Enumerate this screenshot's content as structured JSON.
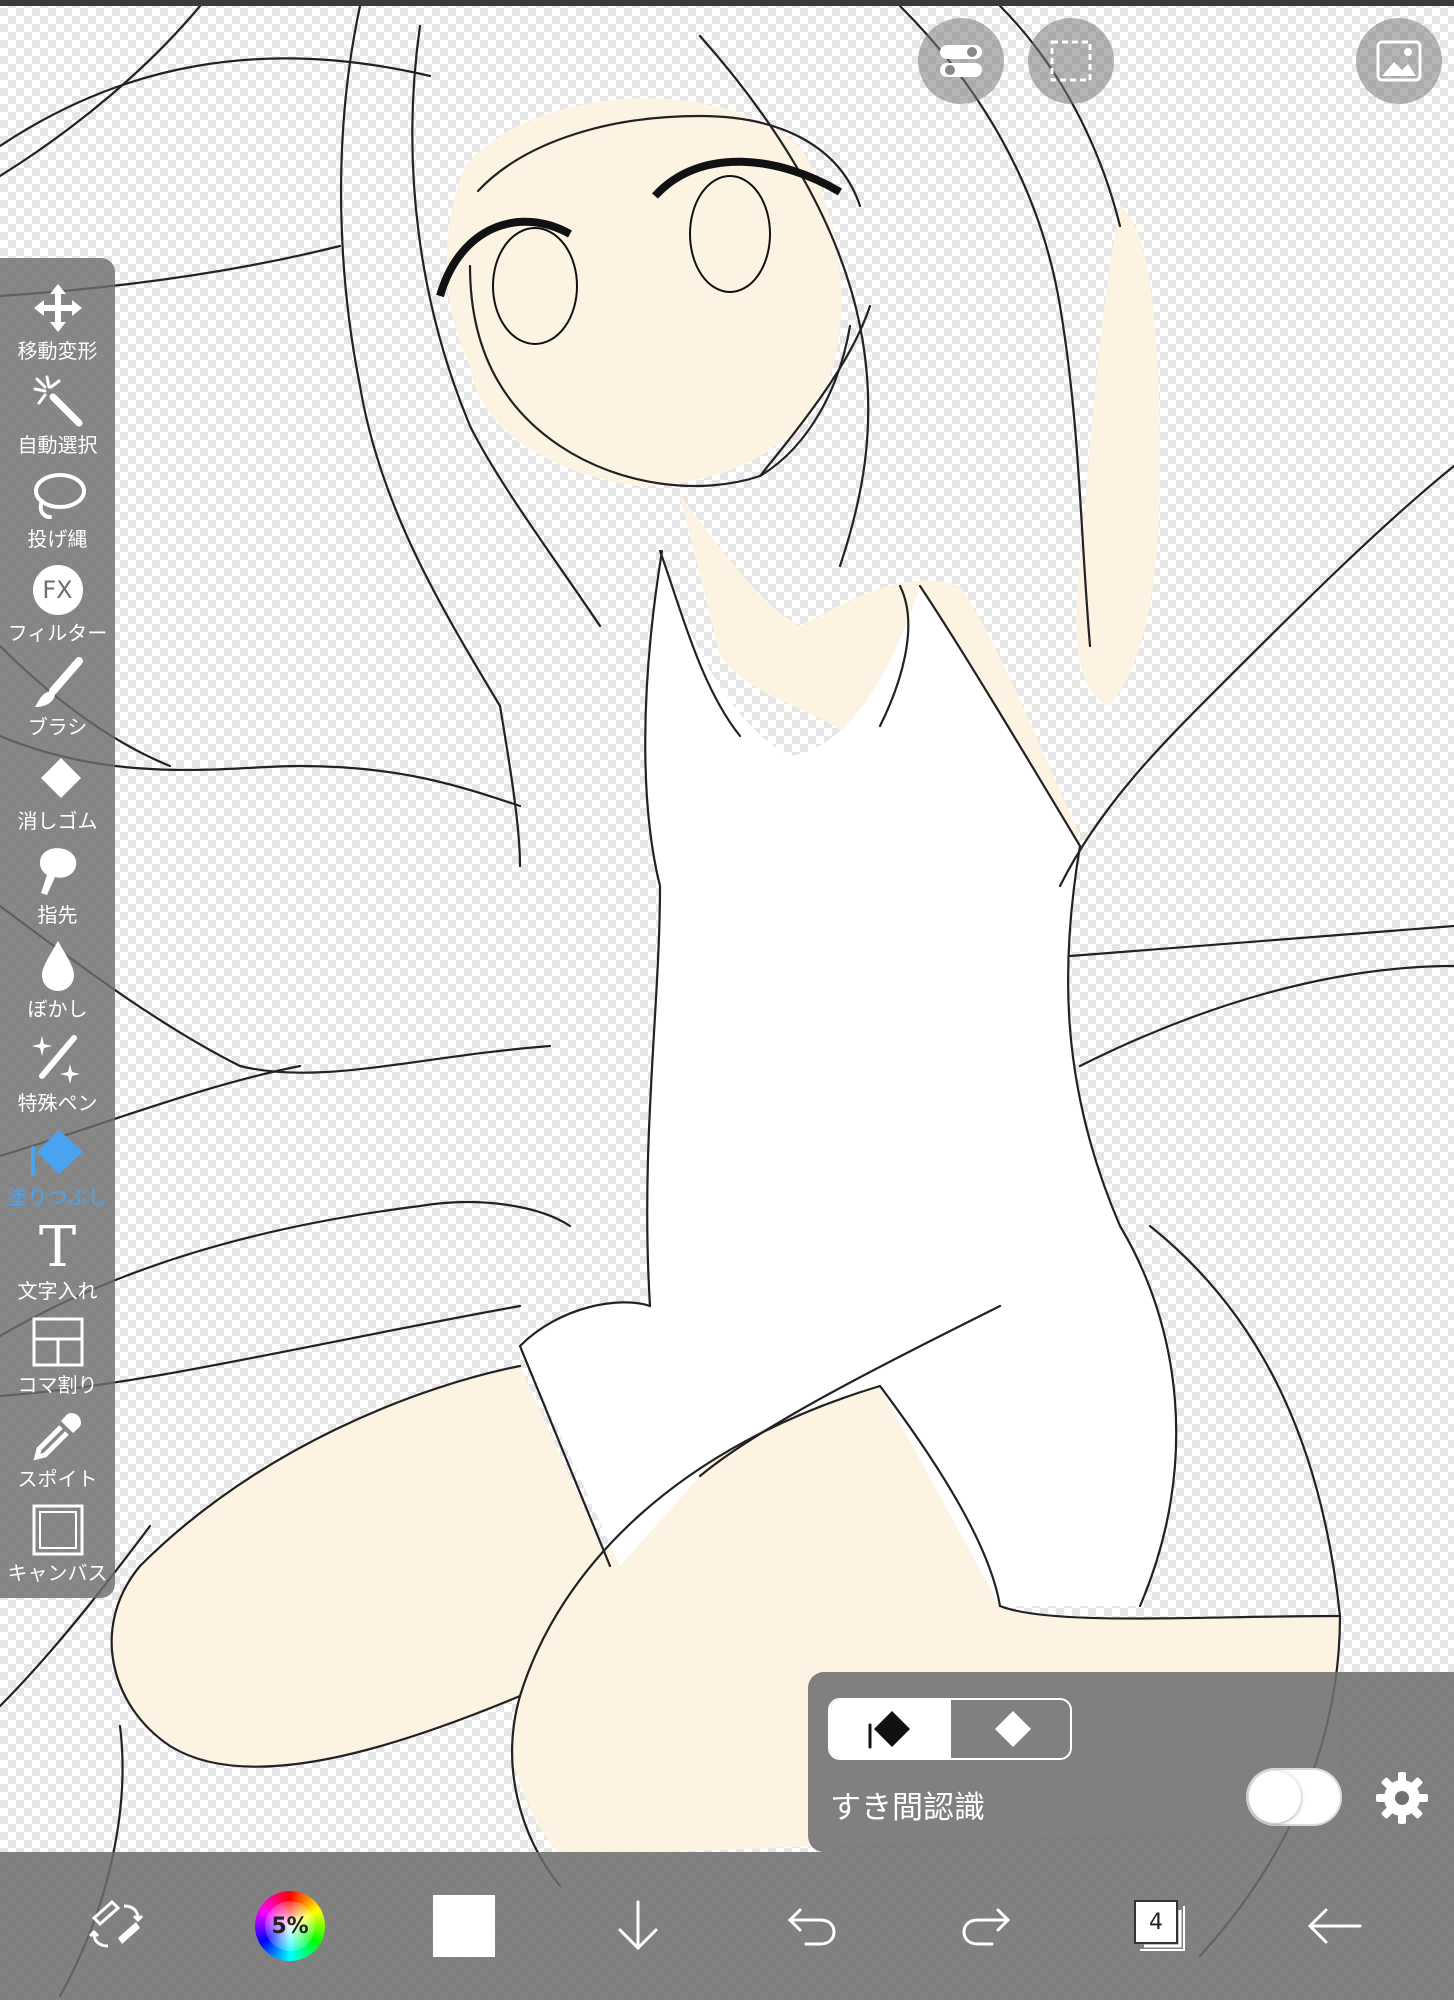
{
  "toolbar": {
    "tools": [
      {
        "id": "move",
        "label": "移動変形",
        "icon": "move-arrows-icon"
      },
      {
        "id": "magic",
        "label": "自動選択",
        "icon": "magic-wand-icon"
      },
      {
        "id": "lasso",
        "label": "投げ縄",
        "icon": "lasso-icon"
      },
      {
        "id": "filter",
        "label": "フィルター",
        "icon": "fx-icon",
        "icon_text": "FX"
      },
      {
        "id": "brush",
        "label": "ブラシ",
        "icon": "brush-icon"
      },
      {
        "id": "eraser",
        "label": "消しゴム",
        "icon": "eraser-icon"
      },
      {
        "id": "smudge",
        "label": "指先",
        "icon": "smudge-icon"
      },
      {
        "id": "blur",
        "label": "ぼかし",
        "icon": "drop-icon"
      },
      {
        "id": "special",
        "label": "特殊ペン",
        "icon": "sparkle-pen-icon"
      },
      {
        "id": "fill",
        "label": "塗りつぶし",
        "icon": "bucket-icon",
        "active": true
      },
      {
        "id": "text",
        "label": "文字入れ",
        "icon": "text-icon",
        "icon_text": "T"
      },
      {
        "id": "frame",
        "label": "コマ割り",
        "icon": "frame-divider-icon"
      },
      {
        "id": "eyedropper",
        "label": "スポイト",
        "icon": "eyedropper-icon"
      },
      {
        "id": "canvas",
        "label": "キャンバス",
        "icon": "canvas-icon"
      }
    ],
    "active_color": "#4aa3f0"
  },
  "fill_panel": {
    "gap_label": "すき間認識",
    "gap_enabled": false
  },
  "bottombar": {
    "opacity_label": "5%",
    "current_color": "#ffffff",
    "layer_count": "4"
  },
  "colors": {
    "skin": "#fdf3e3",
    "line": "#222222",
    "panel": "#707070"
  }
}
